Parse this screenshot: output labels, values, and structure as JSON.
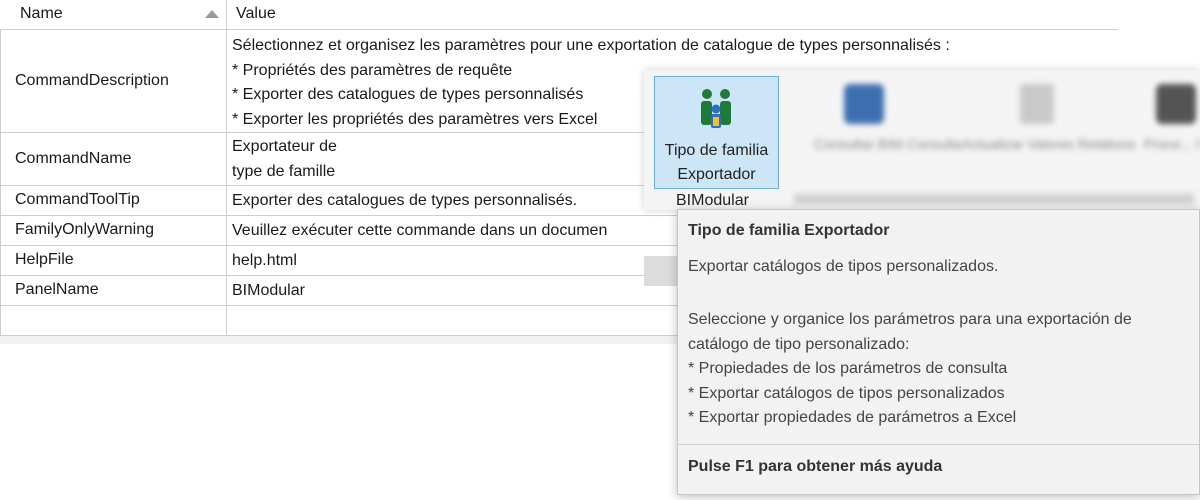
{
  "grid": {
    "headers": {
      "name": "Name",
      "value": "Value"
    },
    "rows": [
      {
        "name": "CommandDescription",
        "value_lines": [
          "Sélectionnez et organisez les paramètres pour une exportation de catalogue de types personnalisés :",
          "* Propriétés des paramètres de requête",
          "* Exporter des catalogues de types personnalisés",
          "* Exporter les propriétés des paramètres vers Excel"
        ]
      },
      {
        "name": "CommandName",
        "value_lines": [
          "Exportateur de",
          "type de famille"
        ]
      },
      {
        "name": "CommandToolTip",
        "value_lines": [
          "Exporter des catalogues de types personnalisés."
        ]
      },
      {
        "name": "FamilyOnlyWarning",
        "value_lines": [
          "Veuillez exécuter cette commande dans un documen"
        ]
      },
      {
        "name": "HelpFile",
        "value_lines": [
          "help.html"
        ]
      },
      {
        "name": "PanelName",
        "value_lines": [
          "BIModular"
        ]
      },
      {
        "name": "",
        "value_lines": [
          ""
        ]
      }
    ]
  },
  "ribbon": {
    "button_label_line1": "Tipo de familia",
    "button_label_line2": "Exportador",
    "group_label": "BIModular",
    "blurred_buttons": [
      "Consultar BIM Consulta",
      "Actualizar Valores Relativos",
      "Proce... Recu..."
    ]
  },
  "tooltip": {
    "title": "Tipo de familia Exportador",
    "description": "Exportar catálogos de tipos personalizados.",
    "body_lines": [
      "Seleccione y organice los parámetros para una exportación de",
      "catálogo de tipo personalizado:",
      "* Propiedades de los parámetros de consulta",
      "* Exportar catálogos de tipos personalizados",
      "* Exportar propiedades de parámetros a Excel"
    ],
    "help": "Pulse F1 para obtener más ayuda"
  }
}
